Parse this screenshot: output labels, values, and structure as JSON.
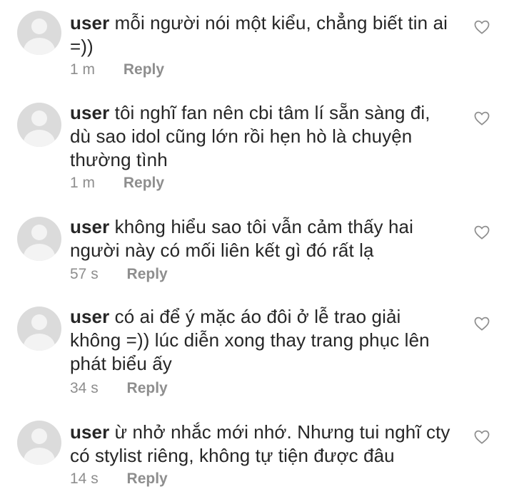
{
  "icons": {
    "avatar": "default-avatar-icon",
    "like": "heart-outline-icon"
  },
  "colors": {
    "text": "#262626",
    "meta": "#8e8e8e",
    "avatar_bg": "#dbdbdb",
    "background": "#ffffff"
  },
  "comments": [
    {
      "username": "user",
      "text": "mỗi người nói một kiểu, chẳng biết tin ai =))",
      "time": "1 m",
      "reply_label": "Reply"
    },
    {
      "username": "user",
      "text": "tôi nghĩ fan nên cbi tâm lí sẵn sàng đi, dù sao idol cũng lớn rồi hẹn hò là chuyện thường tình",
      "time": "1 m",
      "reply_label": "Reply"
    },
    {
      "username": "user",
      "text": "không hiểu sao tôi vẫn cảm thấy hai người này có mối liên kết gì đó rất lạ",
      "time": "57 s",
      "reply_label": "Reply"
    },
    {
      "username": "user",
      "text": "có ai để ý mặc áo đôi ở lễ trao giải không =)) lúc diễn xong thay trang phục lên phát biểu ấy",
      "time": "34 s",
      "reply_label": "Reply"
    },
    {
      "username": "user",
      "text": "ừ nhở nhắc mới nhớ. Nhưng tui nghĩ cty có stylist riêng, không tự tiện được đâu",
      "time": "14 s",
      "reply_label": "Reply"
    }
  ]
}
